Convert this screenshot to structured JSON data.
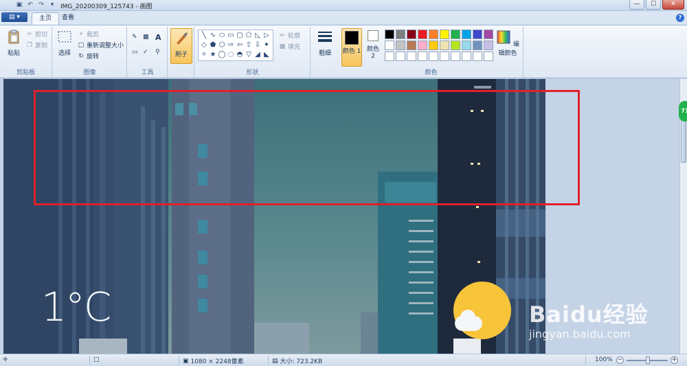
{
  "title_bar": {
    "title": "IMG_20200309_125743 - 画图",
    "qat_icons": [
      "save-icon",
      "undo-icon",
      "redo-icon",
      "dropdown-icon"
    ],
    "minimize": "—",
    "maximize": "☐",
    "close": "✕"
  },
  "tabs": {
    "app_menu": "▤ ▾",
    "items": [
      {
        "label": "主页",
        "active": true
      },
      {
        "label": "查看",
        "active": false
      }
    ],
    "help": "?"
  },
  "ribbon": {
    "clipboard": {
      "label": "剪贴板",
      "paste": "粘贴",
      "cut": "剪切",
      "copy": "复制"
    },
    "image": {
      "label": "图像",
      "select": "选择",
      "crop": "裁剪",
      "resize": "重新调整大小",
      "rotate": "旋转"
    },
    "tools": {
      "label": "工具",
      "text_tool": "A"
    },
    "brushes": {
      "label": "刷子"
    },
    "shapes": {
      "label": "形状",
      "outline": "轮廓",
      "fill": "填充",
      "glyphs": [
        "╲",
        "∿",
        "⬭",
        "▭",
        "▢",
        "⬠",
        "◺",
        "▷",
        "◇",
        "⬟",
        "⬡",
        "⇨",
        "⇦",
        "⇧",
        "⇩",
        "✦",
        "✧",
        "★",
        "◯",
        "◌",
        "◓",
        "▽",
        "◢",
        "◣"
      ]
    },
    "size": {
      "label": "粗细"
    },
    "colors": {
      "label": "颜色",
      "color1": "颜色 1",
      "color2": "颜色 2",
      "edit_colors": "编辑颜色",
      "color1_value": "#000000",
      "color2_value": "#ffffff",
      "palette_row1": [
        "#000000",
        "#7f7f7f",
        "#880015",
        "#ed1c24",
        "#ff7f27",
        "#fff200",
        "#22b14c",
        "#00a2e8",
        "#3f48cc",
        "#a349a4"
      ],
      "palette_row2": [
        "#ffffff",
        "#c3c3c3",
        "#b97a57",
        "#ffaec9",
        "#ffc90e",
        "#efe4b0",
        "#b5e61d",
        "#99d9ea",
        "#7092be",
        "#c8bfe7"
      ],
      "palette_row3": [
        "#ffffff",
        "#ffffff",
        "#ffffff",
        "#ffffff",
        "#ffffff",
        "#ffffff",
        "#ffffff",
        "#ffffff",
        "#ffffff",
        "#ffffff"
      ]
    }
  },
  "canvas": {
    "temperature": "1°C",
    "watermark_logo": "Baidu经验",
    "watermark_sub": "jingyan.baidu.com",
    "annotation_color": "#e0202a",
    "side_badge": "71"
  },
  "status_bar": {
    "dimensions": "1080 × 2248像素",
    "file_size": "大小: 723.2KB",
    "zoom": "100%",
    "zoom_out": "−",
    "zoom_in": "+"
  }
}
